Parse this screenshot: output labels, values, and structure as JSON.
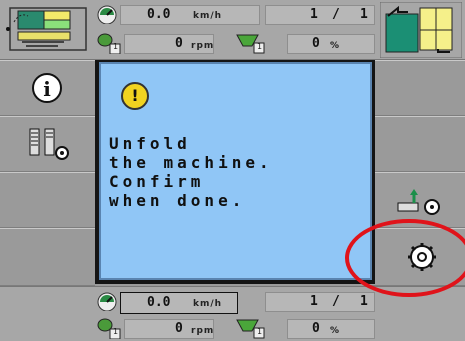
{
  "top_status": {
    "speed_value": "0.0",
    "speed_unit": "km/h",
    "rpm_value": "0",
    "rpm_unit": "rpm",
    "counter_left": "1",
    "counter_sep": "/",
    "counter_right": "1",
    "percent_value": "0",
    "percent_unit": "%",
    "rpm_badge": "1",
    "tank_badge": "1"
  },
  "dialog": {
    "icon": "warning-icon",
    "icon_glyph": "!",
    "message": "Unfold\nthe machine.\nConfirm\nwhen done."
  },
  "bottom_status": {
    "speed_value": "0.0",
    "speed_unit": "km/h",
    "rpm_value": "0",
    "rpm_unit": "rpm",
    "counter_left": "1",
    "counter_sep": "/",
    "counter_right": "1",
    "percent_value": "0",
    "percent_unit": "%",
    "rpm_badge": "1",
    "tank_badge": "1"
  },
  "left_softkeys": [
    "info-icon",
    "tramline-settings-icon"
  ],
  "right_softkeys": [
    "machine-fold-settings-icon",
    "settings-gear-icon"
  ],
  "colors": {
    "dialog_bg": "#90c6f6",
    "warning": "#f1d320",
    "highlight": "#e0131a"
  }
}
